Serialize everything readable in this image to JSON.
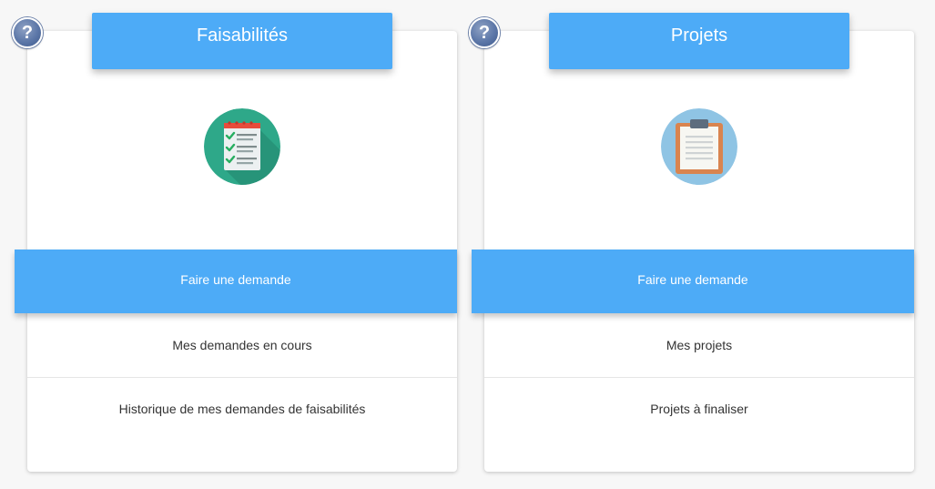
{
  "cards": [
    {
      "title": "Faisabilités",
      "help_label": "?",
      "icon": "checklist-icon",
      "primary_action": "Faire une demande",
      "links": [
        "Mes demandes en cours",
        "Historique de mes demandes de faisabilités"
      ]
    },
    {
      "title": "Projets",
      "help_label": "?",
      "icon": "clipboard-icon",
      "primary_action": "Faire une demande",
      "links": [
        "Mes projets",
        "Projets à finaliser"
      ]
    }
  ],
  "colors": {
    "accent": "#4dabf7",
    "background": "#f7f7f7",
    "card": "#ffffff",
    "text": "#333333",
    "checklist_circle": "#2ea889",
    "clipboard_circle": "#8fc4e4"
  }
}
